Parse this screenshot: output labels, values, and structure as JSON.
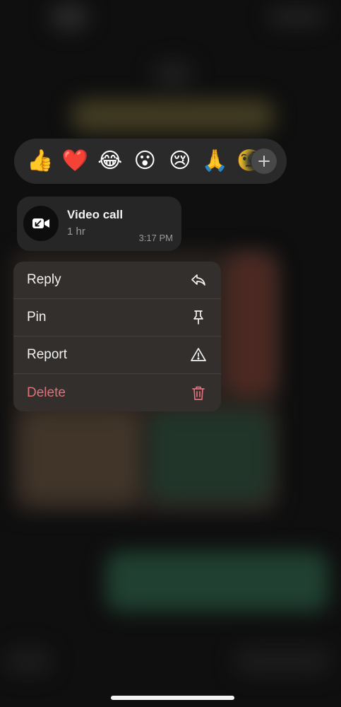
{
  "reactions": {
    "emojis": [
      "👍",
      "❤️",
      "😂",
      "😮",
      "😢",
      "🙏",
      "🧐"
    ],
    "more_icon": "plus-icon"
  },
  "call": {
    "icon": "video-call-missed-icon",
    "title": "Video call",
    "duration": "1 hr",
    "time": "3:17 PM"
  },
  "menu": {
    "items": [
      {
        "label": "Reply",
        "icon": "reply-icon"
      },
      {
        "label": "Pin",
        "icon": "pin-icon"
      },
      {
        "label": "Report",
        "icon": "warning-icon"
      },
      {
        "label": "Delete",
        "icon": "trash-icon"
      }
    ]
  },
  "colors": {
    "danger": "#e0707a",
    "menu_bg": "#34302d",
    "bubble_bg": "#262626"
  }
}
